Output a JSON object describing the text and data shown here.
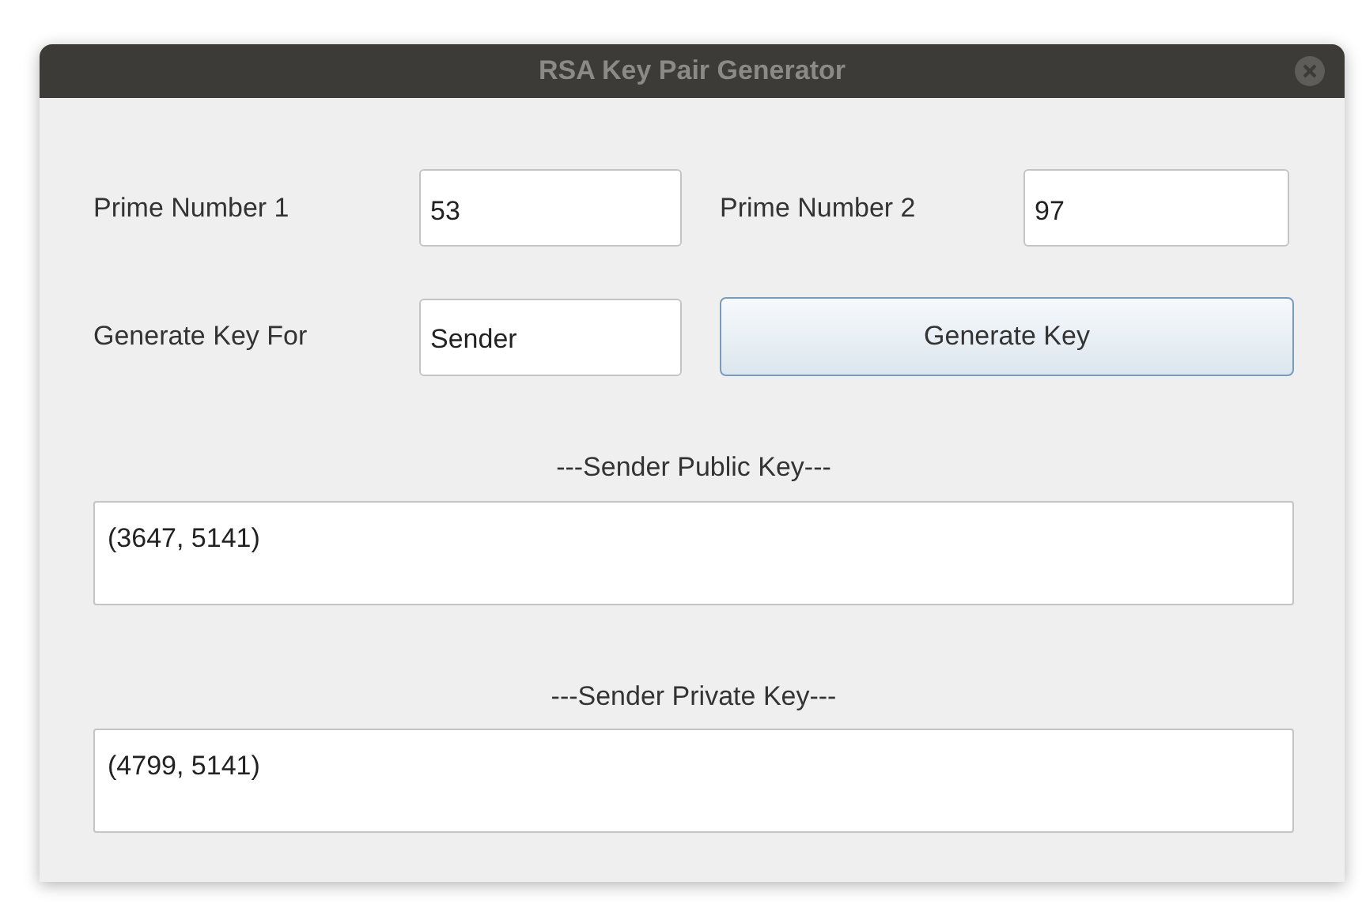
{
  "window": {
    "title": "RSA Key Pair Generator"
  },
  "inputs": [
    {
      "label": "Prime Number 1",
      "value": "53"
    },
    {
      "label": "Prime Number 2",
      "value": "97"
    },
    {
      "label": "Generate Key For",
      "value": "Sender"
    }
  ],
  "generate_button": {
    "label": "Generate Key"
  },
  "outputs": [
    {
      "heading": "---Sender Public Key---",
      "value": "(3647, 5141)"
    },
    {
      "heading": "---Sender Private Key---",
      "value": "(4799, 5141)"
    }
  ]
}
